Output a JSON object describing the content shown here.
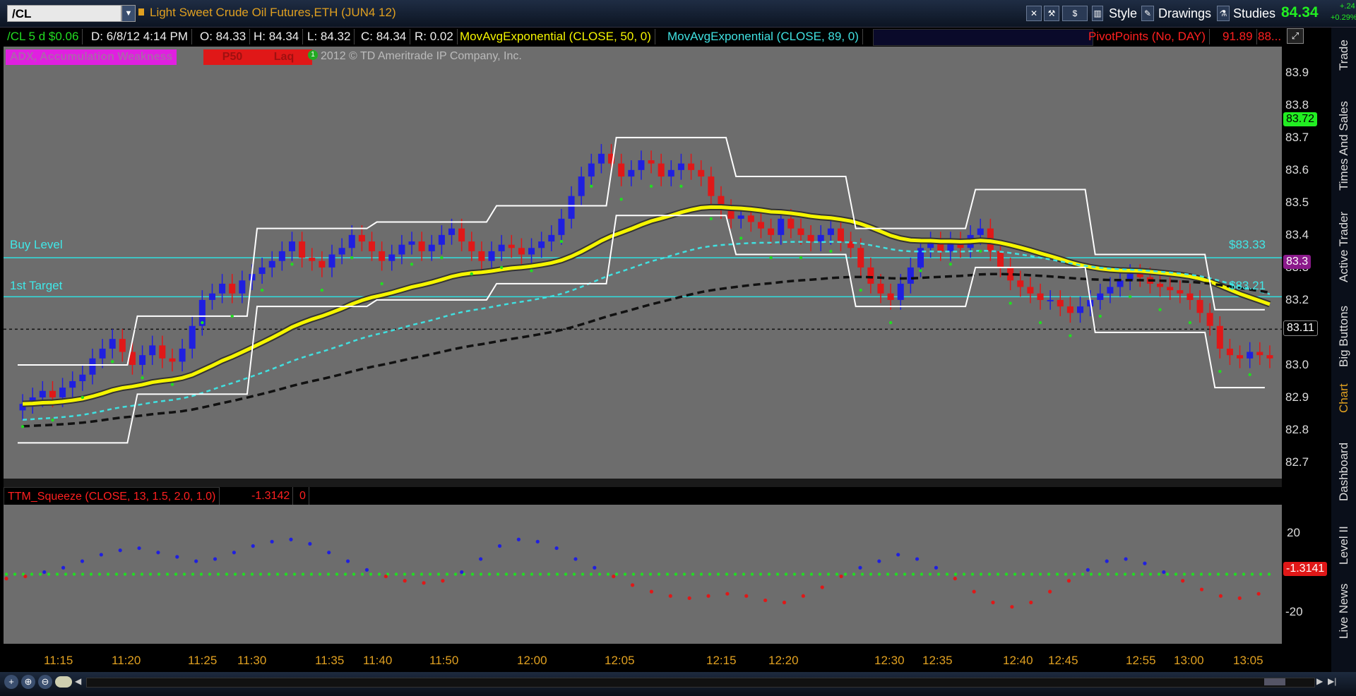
{
  "header": {
    "symbol": "/CL",
    "title": "Light Sweet Crude Oil Futures,ETH (JUN4 12)",
    "buttons": {
      "style": "Style",
      "drawings": "Drawings",
      "studies": "Studies"
    },
    "last_price": "84.34",
    "change": "+.24",
    "change_pct": "+0.29%"
  },
  "info_row": {
    "period": "/CL 5 d $0.06",
    "date": "D: 6/8/12 4:14 PM",
    "open": "O: 84.33",
    "high": "H: 84.34",
    "low": "L: 84.32",
    "close": "C: 84.34",
    "range": "R: 0.02",
    "ema50": "MovAvgExponential (CLOSE, 50, 0)",
    "ema89": "MovAvgExponential (CLOSE, 89, 0)",
    "pivot": "PivotPoints (No, DAY)",
    "pivot_val1": "91.89",
    "pivot_val2": "88..."
  },
  "study_labels": {
    "adx": "ADX, Accumulation Weakness",
    "p50": "P50",
    "laq": "Laq",
    "copyright": "2012 © TD Ameritrade IP Company, Inc."
  },
  "levels": {
    "buy_level": "Buy Level",
    "first_target": "1st Target",
    "buy_level_price": "$83.33",
    "target_price": "$83.21"
  },
  "price_tags": {
    "tag_high": "83.72",
    "tag_mid": "83.3",
    "tag_low": "83.11",
    "squeeze_value": "-1.3141"
  },
  "lower_study": {
    "name": "TTM_Squeeze (CLOSE, 13, 1.5, 2.0, 1.0)",
    "value": "-1.3142",
    "signal": "0"
  },
  "sidebar_tabs": [
    "Trade",
    "Times And Sales",
    "Active Trader",
    "Big Buttons",
    "Chart",
    "Dashboard",
    "Level II",
    "Live News"
  ],
  "colors": {
    "up_bar": "#1f1fe0",
    "down_bar": "#e01818",
    "ema50": "#f5f500",
    "ema89": "#40e0e0",
    "green_dots": "#22dd22",
    "pivot_purple": "#8b1a8b",
    "level_cyan": "#30e0e0",
    "background": "#6d6d6d"
  },
  "chart_data": [
    {
      "type": "candlestick",
      "title": "Light Sweet Crude Oil Futures,ETH (JUN4 12)",
      "x_ticks": [
        "11:15",
        "11:20",
        "11:25",
        "11:30",
        "11:35",
        "11:40",
        "11:50",
        "12:00",
        "12:05",
        "12:15",
        "12:20",
        "12:30",
        "12:35",
        "12:40",
        "12:45",
        "12:55",
        "13:00",
        "13:05"
      ],
      "y_ticks": [
        83.9,
        83.8,
        83.7,
        83.6,
        83.5,
        83.4,
        83.3,
        83.2,
        83.1,
        83.0,
        82.9,
        82.8,
        82.7
      ],
      "ylim": [
        82.65,
        83.98
      ],
      "horizontal_levels": [
        {
          "name": "Buy Level",
          "value": 83.33
        },
        {
          "name": "1st Target",
          "value": 83.21
        },
        {
          "name": "last close line",
          "value": 83.11
        }
      ],
      "closes": [
        82.88,
        82.9,
        82.92,
        82.9,
        82.93,
        82.95,
        82.97,
        83.02,
        83.05,
        83.08,
        83.04,
        83.0,
        83.03,
        83.06,
        83.02,
        83.01,
        83.05,
        83.12,
        83.2,
        83.22,
        83.25,
        83.22,
        83.26,
        83.28,
        83.3,
        83.32,
        83.35,
        83.38,
        83.33,
        83.32,
        83.3,
        83.34,
        83.36,
        83.4,
        83.38,
        83.35,
        83.32,
        83.34,
        83.37,
        83.38,
        83.35,
        83.37,
        83.4,
        83.42,
        83.38,
        83.35,
        83.32,
        83.35,
        83.37,
        83.36,
        83.34,
        83.36,
        83.38,
        83.4,
        83.45,
        83.52,
        83.58,
        83.62,
        83.65,
        83.62,
        83.58,
        83.6,
        83.63,
        83.62,
        83.58,
        83.6,
        83.62,
        83.6,
        83.58,
        83.52,
        83.48,
        83.45,
        83.46,
        83.44,
        83.42,
        83.4,
        83.45,
        83.42,
        83.4,
        83.38,
        83.4,
        83.42,
        83.38,
        83.36,
        83.3,
        83.25,
        83.22,
        83.2,
        83.25,
        83.3,
        83.36,
        83.38,
        83.35,
        83.38,
        83.36,
        83.4,
        83.42,
        83.35,
        83.3,
        83.26,
        83.24,
        83.22,
        83.2,
        83.2,
        83.18,
        83.16,
        83.18,
        83.2,
        83.22,
        83.24,
        83.26,
        83.28,
        83.27,
        83.25,
        83.24,
        83.23,
        83.22,
        83.2,
        83.16,
        83.12,
        83.05,
        83.03,
        83.02,
        83.04,
        83.03,
        83.02
      ]
    },
    {
      "type": "line",
      "title": "TTM_Squeeze (CLOSE, 13, 1.5, 2.0, 1.0)",
      "y_ticks": [
        20,
        -20
      ],
      "ylim": [
        -32,
        32
      ],
      "momentum": [
        -2,
        -1,
        1,
        3,
        6,
        9,
        11,
        12,
        10,
        8,
        6,
        7,
        10,
        13,
        15,
        16,
        14,
        10,
        6,
        2,
        -1,
        -3,
        -4,
        -3,
        1,
        7,
        13,
        16,
        15,
        12,
        7,
        3,
        -1,
        -5,
        -8,
        -10,
        -11,
        -10,
        -9,
        -10,
        -12,
        -13,
        -10,
        -6,
        -1,
        3,
        6,
        9,
        7,
        3,
        -2,
        -8,
        -13,
        -15,
        -13,
        -8,
        -3,
        2,
        6,
        7,
        5,
        1,
        -3,
        -7,
        -10,
        -11,
        -9
      ],
      "zero_line": 0,
      "current_value": -1.3141
    }
  ]
}
